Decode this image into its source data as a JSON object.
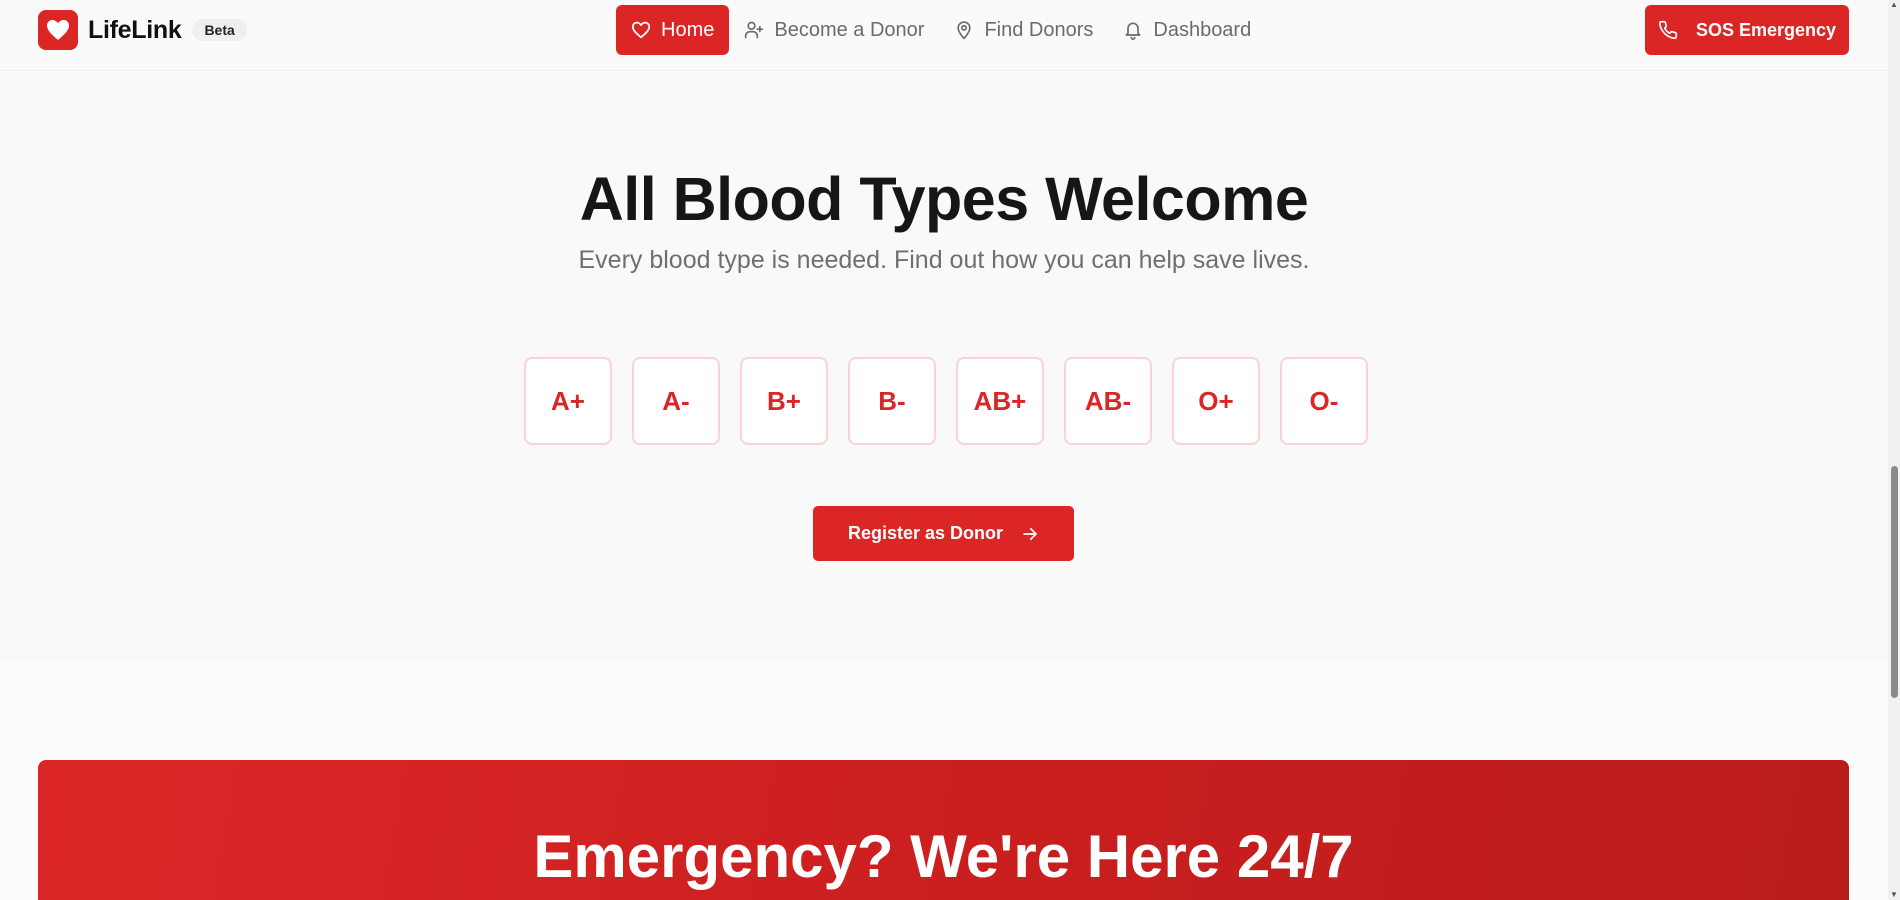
{
  "brand": {
    "name": "LifeLink",
    "badge": "Beta",
    "logo_icon": "heart-icon"
  },
  "nav": {
    "items": [
      {
        "label": "Home",
        "icon": "heart-icon",
        "active": true
      },
      {
        "label": "Become a Donor",
        "icon": "user-plus-icon",
        "active": false
      },
      {
        "label": "Find Donors",
        "icon": "map-pin-icon",
        "active": false
      },
      {
        "label": "Dashboard",
        "icon": "bell-icon",
        "active": false
      }
    ],
    "sos_label": "SOS Emergency",
    "sos_icon": "phone-icon"
  },
  "hero": {
    "title": "All Blood Types Welcome",
    "subtitle": "Every blood type is needed. Find out how you can help save lives.",
    "blood_types": [
      "A+",
      "A-",
      "B+",
      "B-",
      "AB+",
      "AB-",
      "O+",
      "O-"
    ],
    "register_label": "Register as Donor",
    "register_icon": "arrow-right-icon"
  },
  "emergency": {
    "title": "Emergency? We're Here 24/7"
  },
  "colors": {
    "accent": "#dc2626",
    "accent_dark": "#b91c1c",
    "blood_type_border": "#fbd3d3"
  }
}
